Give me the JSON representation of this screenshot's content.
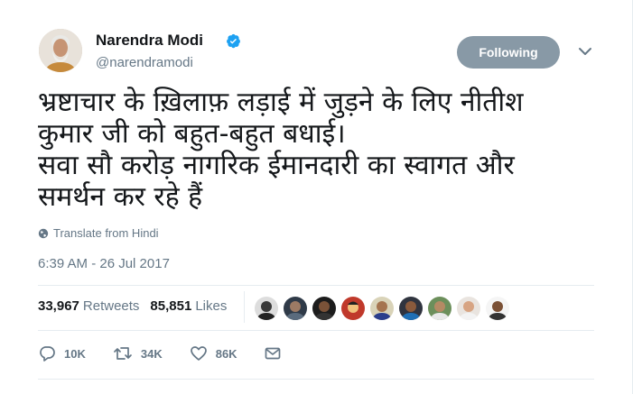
{
  "author": {
    "name": "Narendra Modi",
    "handle": "@narendramodi",
    "verified": true
  },
  "follow_button": {
    "label": "Following"
  },
  "tweet": {
    "lines": [
      "भ्रष्टाचार के ख़िलाफ़ लड़ाई में जुड़ने के लिए नीतीश",
      "कुमार जी को बहुत-बहुत बधाई।",
      "सवा सौ करोड़ नागरिक ईमानदारी का स्वागत और",
      "समर्थन कर रहे हैं"
    ]
  },
  "translate": {
    "label": "Translate from Hindi",
    "icon": "globe-icon"
  },
  "timestamp": "6:39 AM - 26 Jul 2017",
  "stats": {
    "retweets": {
      "count": "33,967",
      "label": "Retweets"
    },
    "likes": {
      "count": "85,851",
      "label": "Likes"
    }
  },
  "actions": {
    "reply": {
      "count": "10K",
      "icon": "reply-icon"
    },
    "retweet": {
      "count": "34K",
      "icon": "retweet-icon"
    },
    "like": {
      "count": "86K",
      "icon": "heart-icon"
    },
    "message": {
      "icon": "envelope-icon"
    }
  },
  "colors": {
    "text": "#14171a",
    "secondary": "#657786",
    "follow_button": "#8899a6",
    "verified": "#1da1f2",
    "divider": "#e6ecf0"
  }
}
